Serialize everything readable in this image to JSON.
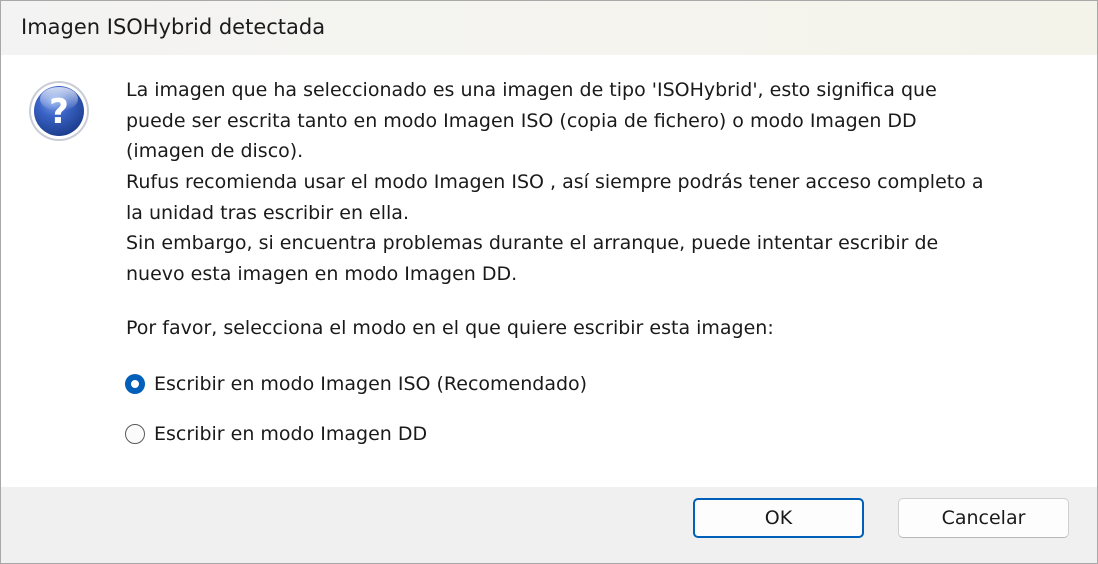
{
  "window": {
    "title": "Imagen ISOHybrid detectada"
  },
  "dialog": {
    "icon": "question-icon",
    "icon_glyph": "?",
    "message_lines": [
      "La imagen que ha seleccionado es una imagen de tipo 'ISOHybrid', esto significa que",
      "puede ser escrita tanto en modo Imagen ISO (copia de fichero) o modo Imagen DD",
      "(imagen de disco).",
      "Rufus recomienda usar el modo Imagen ISO , así siempre podrás tener acceso completo a",
      "la unidad tras escribir en ella.",
      "Sin embargo, si encuentra problemas durante el arranque, puede intentar escribir de",
      "nuevo esta imagen en modo Imagen DD."
    ],
    "prompt": "Por favor, selecciona el modo en el que quiere escribir esta imagen:",
    "options": [
      {
        "label": "Escribir en modo Imagen ISO (Recomendado)",
        "selected": true
      },
      {
        "label": "Escribir en modo Imagen DD",
        "selected": false
      }
    ]
  },
  "buttons": {
    "ok": "OK",
    "cancel": "Cancelar"
  },
  "colors": {
    "accent": "#005fb8",
    "footer_bg": "#f0f0f0",
    "icon_blue": "#2a55b8"
  }
}
